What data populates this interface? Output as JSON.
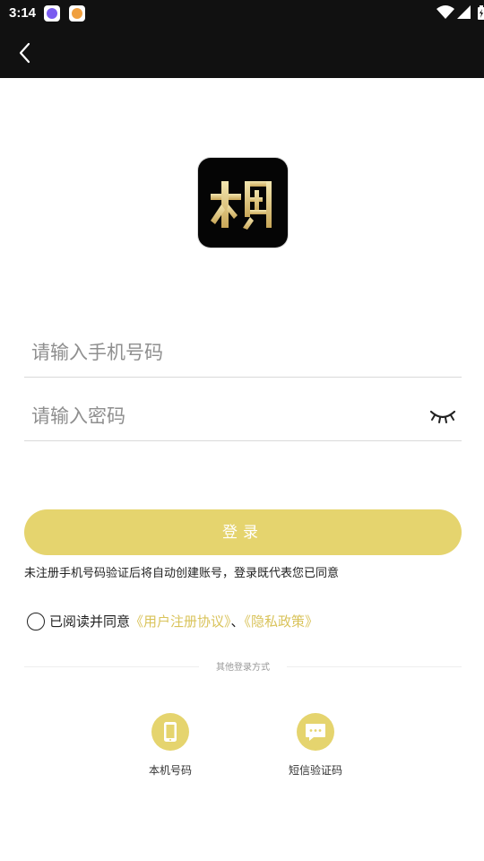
{
  "status_bar": {
    "time": "3:14",
    "notification_icons": [
      "app-notification-purple-icon",
      "app-notification-orange-icon"
    ],
    "right_icons": [
      "wifi-icon",
      "cellular-signal-icon",
      "battery-charging-icon"
    ]
  },
  "nav": {
    "back_icon": "chevron-left-icon"
  },
  "logo": {
    "icon": "app-logo-icon"
  },
  "form": {
    "phone_placeholder": "请输入手机号码",
    "phone_value": "",
    "password_placeholder": "请输入密码",
    "password_value": "",
    "password_toggle_icon": "eye-closed-icon"
  },
  "login_button": {
    "label": "登录"
  },
  "notice": "未注册手机号码验证后将自动创建账号，登录既代表您已同意",
  "agreement": {
    "checked": false,
    "prefix": "已阅读并同意",
    "user_agreement": "《用户注册协议》",
    "separator": "、",
    "privacy_policy": "《隐私政策》"
  },
  "other_login": {
    "title": "其他登录方式",
    "methods": [
      {
        "label": "本机号码",
        "icon": "mobile-phone-icon"
      },
      {
        "label": "短信验证码",
        "icon": "chat-bubble-icon"
      }
    ]
  },
  "colors": {
    "accent": "#E5D46E",
    "link": "#D9C35A",
    "header_bg": "#111111"
  }
}
